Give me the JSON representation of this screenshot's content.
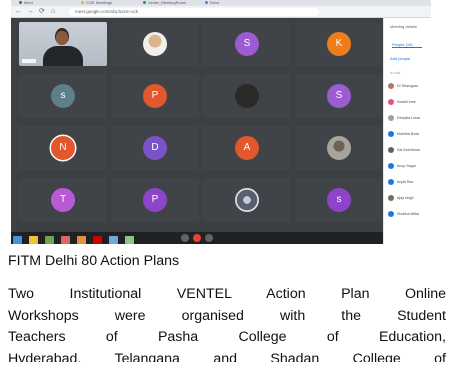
{
  "browser": {
    "tabs": [
      "Meet",
      "COE Meetings",
      "Ventel_MeetingRoom",
      "Drive"
    ],
    "url": "meet.google.com/ufq-bozm-uck",
    "nav_glyphs": [
      "←",
      "→",
      "⟳",
      "⌂"
    ]
  },
  "meeting": {
    "tiles": [
      {
        "kind": "speaker"
      },
      {
        "kind": "photo",
        "letter": ""
      },
      {
        "kind": "letter",
        "letter": "S",
        "color": "#9c5bd1"
      },
      {
        "kind": "letter",
        "letter": "K",
        "color": "#ef7c1a"
      },
      {
        "kind": "letter",
        "letter": "s",
        "color": "#607d8b"
      },
      {
        "kind": "letter",
        "letter": "P",
        "color": "#e2572b"
      },
      {
        "kind": "dark",
        "letter": ""
      },
      {
        "kind": "letter",
        "letter": "S",
        "color": "#9c5bd1"
      },
      {
        "kind": "letter",
        "letter": "N",
        "color": "#e2572b",
        "ring": true
      },
      {
        "kind": "letter",
        "letter": "D",
        "color": "#7b52c9"
      },
      {
        "kind": "letter",
        "letter": "A",
        "color": "#e2572b"
      },
      {
        "kind": "photo2",
        "letter": ""
      },
      {
        "kind": "letter",
        "letter": "T",
        "color": "#b85ad6"
      },
      {
        "kind": "letter",
        "letter": "P",
        "color": "#8e44c9"
      },
      {
        "kind": "photo3",
        "letter": ""
      },
      {
        "kind": "letter",
        "letter": "s",
        "color": "#8e44c9"
      }
    ],
    "side_panel": {
      "header": "Meeting details",
      "tab": "People (16)",
      "add": "Add people",
      "section": "In call",
      "people": [
        {
          "name": "Dr Shanigaru",
          "color": "#b07a5a"
        },
        {
          "name": "Swathi sree",
          "color": "#e94d8a"
        },
        {
          "name": "Deepika Lohar",
          "color": "#9aa0a6"
        },
        {
          "name": "Mahitha Boda",
          "color": "#1a73e8"
        },
        {
          "name": "Sai Keerthana",
          "color": "#5f6368"
        },
        {
          "name": "Anup Sagar",
          "color": "#1a73e8"
        },
        {
          "name": "Anjali Rao",
          "color": "#1a73e8"
        },
        {
          "name": "Ajay singh",
          "color": "#7a6a5a"
        },
        {
          "name": "Shubha Mittal",
          "color": "#1a73e8"
        }
      ]
    }
  },
  "taskbar": {
    "icons": [
      "#4a90d9",
      "#f1c232",
      "#6aa84f",
      "#e06666",
      "#e69138",
      "#cc0000",
      "#6fa8dc",
      "#93c47d"
    ]
  },
  "document": {
    "title": "FITM Delhi 80 Action Plans",
    "paragraph_lines": [
      "Two Institutional VENTEL Action Plan Online",
      "Workshops were organised with the Student",
      "Teachers of Pasha College of Education,",
      "Hyderabad, Telangana and Shadan College of"
    ]
  }
}
